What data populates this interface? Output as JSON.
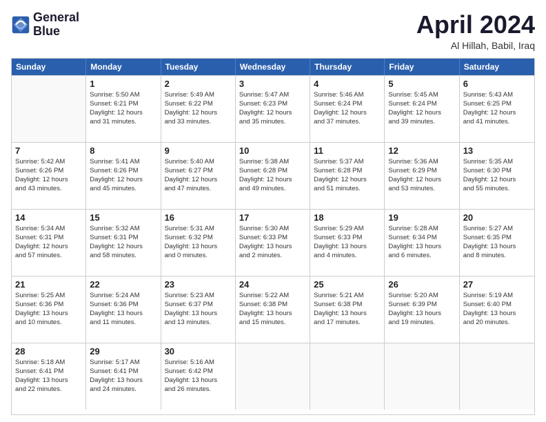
{
  "header": {
    "logo_line1": "General",
    "logo_line2": "Blue",
    "month": "April 2024",
    "location": "Al Hillah, Babil, Iraq"
  },
  "weekdays": [
    "Sunday",
    "Monday",
    "Tuesday",
    "Wednesday",
    "Thursday",
    "Friday",
    "Saturday"
  ],
  "rows": [
    [
      {
        "day": "",
        "sunrise": "",
        "sunset": "",
        "daylight": ""
      },
      {
        "day": "1",
        "sunrise": "Sunrise: 5:50 AM",
        "sunset": "Sunset: 6:21 PM",
        "daylight": "Daylight: 12 hours",
        "daylight2": "and 31 minutes."
      },
      {
        "day": "2",
        "sunrise": "Sunrise: 5:49 AM",
        "sunset": "Sunset: 6:22 PM",
        "daylight": "Daylight: 12 hours",
        "daylight2": "and 33 minutes."
      },
      {
        "day": "3",
        "sunrise": "Sunrise: 5:47 AM",
        "sunset": "Sunset: 6:23 PM",
        "daylight": "Daylight: 12 hours",
        "daylight2": "and 35 minutes."
      },
      {
        "day": "4",
        "sunrise": "Sunrise: 5:46 AM",
        "sunset": "Sunset: 6:24 PM",
        "daylight": "Daylight: 12 hours",
        "daylight2": "and 37 minutes."
      },
      {
        "day": "5",
        "sunrise": "Sunrise: 5:45 AM",
        "sunset": "Sunset: 6:24 PM",
        "daylight": "Daylight: 12 hours",
        "daylight2": "and 39 minutes."
      },
      {
        "day": "6",
        "sunrise": "Sunrise: 5:43 AM",
        "sunset": "Sunset: 6:25 PM",
        "daylight": "Daylight: 12 hours",
        "daylight2": "and 41 minutes."
      }
    ],
    [
      {
        "day": "7",
        "sunrise": "Sunrise: 5:42 AM",
        "sunset": "Sunset: 6:26 PM",
        "daylight": "Daylight: 12 hours",
        "daylight2": "and 43 minutes."
      },
      {
        "day": "8",
        "sunrise": "Sunrise: 5:41 AM",
        "sunset": "Sunset: 6:26 PM",
        "daylight": "Daylight: 12 hours",
        "daylight2": "and 45 minutes."
      },
      {
        "day": "9",
        "sunrise": "Sunrise: 5:40 AM",
        "sunset": "Sunset: 6:27 PM",
        "daylight": "Daylight: 12 hours",
        "daylight2": "and 47 minutes."
      },
      {
        "day": "10",
        "sunrise": "Sunrise: 5:38 AM",
        "sunset": "Sunset: 6:28 PM",
        "daylight": "Daylight: 12 hours",
        "daylight2": "and 49 minutes."
      },
      {
        "day": "11",
        "sunrise": "Sunrise: 5:37 AM",
        "sunset": "Sunset: 6:28 PM",
        "daylight": "Daylight: 12 hours",
        "daylight2": "and 51 minutes."
      },
      {
        "day": "12",
        "sunrise": "Sunrise: 5:36 AM",
        "sunset": "Sunset: 6:29 PM",
        "daylight": "Daylight: 12 hours",
        "daylight2": "and 53 minutes."
      },
      {
        "day": "13",
        "sunrise": "Sunrise: 5:35 AM",
        "sunset": "Sunset: 6:30 PM",
        "daylight": "Daylight: 12 hours",
        "daylight2": "and 55 minutes."
      }
    ],
    [
      {
        "day": "14",
        "sunrise": "Sunrise: 5:34 AM",
        "sunset": "Sunset: 6:31 PM",
        "daylight": "Daylight: 12 hours",
        "daylight2": "and 57 minutes."
      },
      {
        "day": "15",
        "sunrise": "Sunrise: 5:32 AM",
        "sunset": "Sunset: 6:31 PM",
        "daylight": "Daylight: 12 hours",
        "daylight2": "and 58 minutes."
      },
      {
        "day": "16",
        "sunrise": "Sunrise: 5:31 AM",
        "sunset": "Sunset: 6:32 PM",
        "daylight": "Daylight: 13 hours",
        "daylight2": "and 0 minutes."
      },
      {
        "day": "17",
        "sunrise": "Sunrise: 5:30 AM",
        "sunset": "Sunset: 6:33 PM",
        "daylight": "Daylight: 13 hours",
        "daylight2": "and 2 minutes."
      },
      {
        "day": "18",
        "sunrise": "Sunrise: 5:29 AM",
        "sunset": "Sunset: 6:33 PM",
        "daylight": "Daylight: 13 hours",
        "daylight2": "and 4 minutes."
      },
      {
        "day": "19",
        "sunrise": "Sunrise: 5:28 AM",
        "sunset": "Sunset: 6:34 PM",
        "daylight": "Daylight: 13 hours",
        "daylight2": "and 6 minutes."
      },
      {
        "day": "20",
        "sunrise": "Sunrise: 5:27 AM",
        "sunset": "Sunset: 6:35 PM",
        "daylight": "Daylight: 13 hours",
        "daylight2": "and 8 minutes."
      }
    ],
    [
      {
        "day": "21",
        "sunrise": "Sunrise: 5:25 AM",
        "sunset": "Sunset: 6:36 PM",
        "daylight": "Daylight: 13 hours",
        "daylight2": "and 10 minutes."
      },
      {
        "day": "22",
        "sunrise": "Sunrise: 5:24 AM",
        "sunset": "Sunset: 6:36 PM",
        "daylight": "Daylight: 13 hours",
        "daylight2": "and 11 minutes."
      },
      {
        "day": "23",
        "sunrise": "Sunrise: 5:23 AM",
        "sunset": "Sunset: 6:37 PM",
        "daylight": "Daylight: 13 hours",
        "daylight2": "and 13 minutes."
      },
      {
        "day": "24",
        "sunrise": "Sunrise: 5:22 AM",
        "sunset": "Sunset: 6:38 PM",
        "daylight": "Daylight: 13 hours",
        "daylight2": "and 15 minutes."
      },
      {
        "day": "25",
        "sunrise": "Sunrise: 5:21 AM",
        "sunset": "Sunset: 6:38 PM",
        "daylight": "Daylight: 13 hours",
        "daylight2": "and 17 minutes."
      },
      {
        "day": "26",
        "sunrise": "Sunrise: 5:20 AM",
        "sunset": "Sunset: 6:39 PM",
        "daylight": "Daylight: 13 hours",
        "daylight2": "and 19 minutes."
      },
      {
        "day": "27",
        "sunrise": "Sunrise: 5:19 AM",
        "sunset": "Sunset: 6:40 PM",
        "daylight": "Daylight: 13 hours",
        "daylight2": "and 20 minutes."
      }
    ],
    [
      {
        "day": "28",
        "sunrise": "Sunrise: 5:18 AM",
        "sunset": "Sunset: 6:41 PM",
        "daylight": "Daylight: 13 hours",
        "daylight2": "and 22 minutes."
      },
      {
        "day": "29",
        "sunrise": "Sunrise: 5:17 AM",
        "sunset": "Sunset: 6:41 PM",
        "daylight": "Daylight: 13 hours",
        "daylight2": "and 24 minutes."
      },
      {
        "day": "30",
        "sunrise": "Sunrise: 5:16 AM",
        "sunset": "Sunset: 6:42 PM",
        "daylight": "Daylight: 13 hours",
        "daylight2": "and 26 minutes."
      },
      {
        "day": "",
        "sunrise": "",
        "sunset": "",
        "daylight": ""
      },
      {
        "day": "",
        "sunrise": "",
        "sunset": "",
        "daylight": ""
      },
      {
        "day": "",
        "sunrise": "",
        "sunset": "",
        "daylight": ""
      },
      {
        "day": "",
        "sunrise": "",
        "sunset": "",
        "daylight": ""
      }
    ]
  ]
}
